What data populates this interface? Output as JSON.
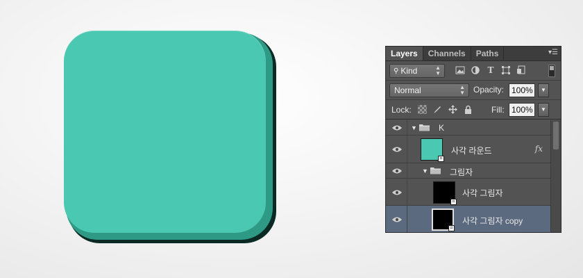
{
  "colors": {
    "icon_face": "#4ac8b1",
    "icon_side": "#2e9a85",
    "icon_shadow": "#0b2a24",
    "panel_bg": "#535353",
    "selected_row": "#5c6a7f"
  },
  "panel": {
    "tabs": [
      {
        "label": "Layers",
        "active": true
      },
      {
        "label": "Channels",
        "active": false
      },
      {
        "label": "Paths",
        "active": false
      }
    ],
    "filter": {
      "kind_label": "Kind",
      "icons": [
        "image-filter-icon",
        "adjustment-filter-icon",
        "type-filter-icon",
        "shape-filter-icon",
        "smart-object-filter-icon"
      ]
    },
    "blend_mode": "Normal",
    "opacity_label": "Opacity:",
    "opacity_value": "100%",
    "lock_label": "Lock:",
    "fill_label": "Fill:",
    "fill_value": "100%",
    "layers": [
      {
        "name": "K",
        "type": "group",
        "expanded": true,
        "indent": 0,
        "selected": false
      },
      {
        "name": "사각 라운드",
        "type": "shape",
        "fx": "fx",
        "thumb_color": "#4ac8b1",
        "indent": 1,
        "selected": false
      },
      {
        "name": "그림자",
        "type": "group",
        "expanded": true,
        "indent": 1,
        "selected": false
      },
      {
        "name": "사각 그림자",
        "type": "shape",
        "thumb_color": "#000000",
        "indent": 2,
        "selected": false
      },
      {
        "name": "사각 그림자 copy",
        "type": "shape",
        "thumb_color": "#000000",
        "indent": 2,
        "selected": true
      }
    ]
  }
}
